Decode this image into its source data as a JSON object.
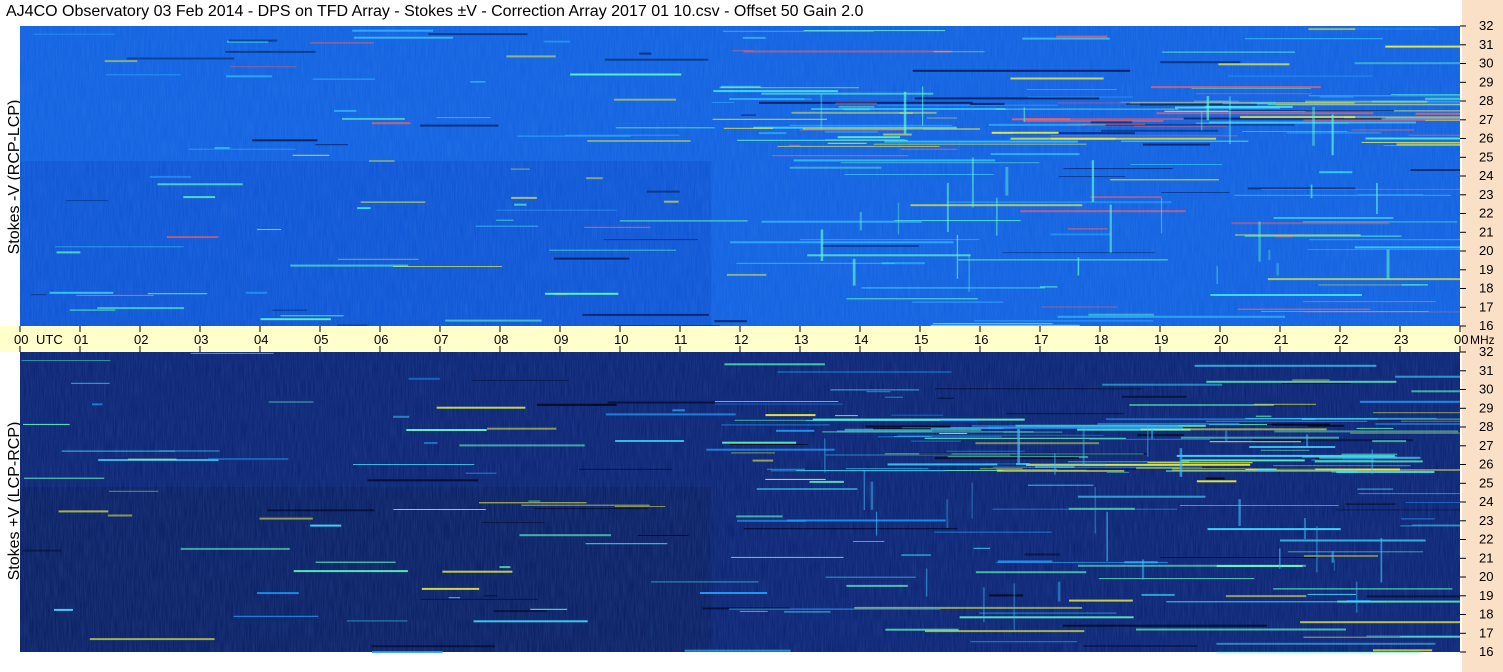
{
  "title": "AJ4CO Observatory  03 Feb 2014  -  DPS on TFD Array  -  Stokes ±V  -  Correction Array 2017 01 10.csv  -  Offset 50  Gain 2.0",
  "colors": {
    "time_axis_bg": "#ffffcc",
    "freq_axis_bg": "#fbe0c8",
    "upper_base": "#1060e0",
    "lower_base": "#0a2070",
    "bright_cyan": "#40e0ff",
    "yellow": "#e8f040"
  },
  "chart_data": [
    {
      "type": "heatmap",
      "panel": "upper",
      "ylabel": "Stokes -V (RCP-LCP)",
      "xlabel": "UTC",
      "x_ticks": [
        "00",
        "01",
        "02",
        "03",
        "04",
        "05",
        "06",
        "07",
        "08",
        "09",
        "10",
        "11",
        "12",
        "13",
        "14",
        "15",
        "16",
        "17",
        "18",
        "19",
        "20",
        "21",
        "22",
        "23",
        "00"
      ],
      "y_ticks": [
        "16",
        "17",
        "18",
        "19",
        "20",
        "21",
        "22",
        "23",
        "24",
        "25",
        "26",
        "27",
        "28",
        "29",
        "30",
        "31",
        "32"
      ],
      "y_unit": "MHz",
      "xlim": [
        0,
        24
      ],
      "ylim": [
        16,
        32
      ]
    },
    {
      "type": "heatmap",
      "panel": "lower",
      "ylabel": "Stokes +V (LCP-RCP)",
      "x_ticks": [
        "00",
        "01",
        "02",
        "03",
        "04",
        "05",
        "06",
        "07",
        "08",
        "09",
        "10",
        "11",
        "12",
        "13",
        "14",
        "15",
        "16",
        "17",
        "18",
        "19",
        "20",
        "21",
        "22",
        "23",
        "00"
      ],
      "y_ticks": [
        "16",
        "17",
        "18",
        "19",
        "20",
        "21",
        "22",
        "23",
        "24",
        "25",
        "26",
        "27",
        "28",
        "29",
        "30",
        "31",
        "32"
      ],
      "y_unit": "MHz",
      "xlim": [
        0,
        24
      ],
      "ylim": [
        16,
        32
      ]
    }
  ]
}
